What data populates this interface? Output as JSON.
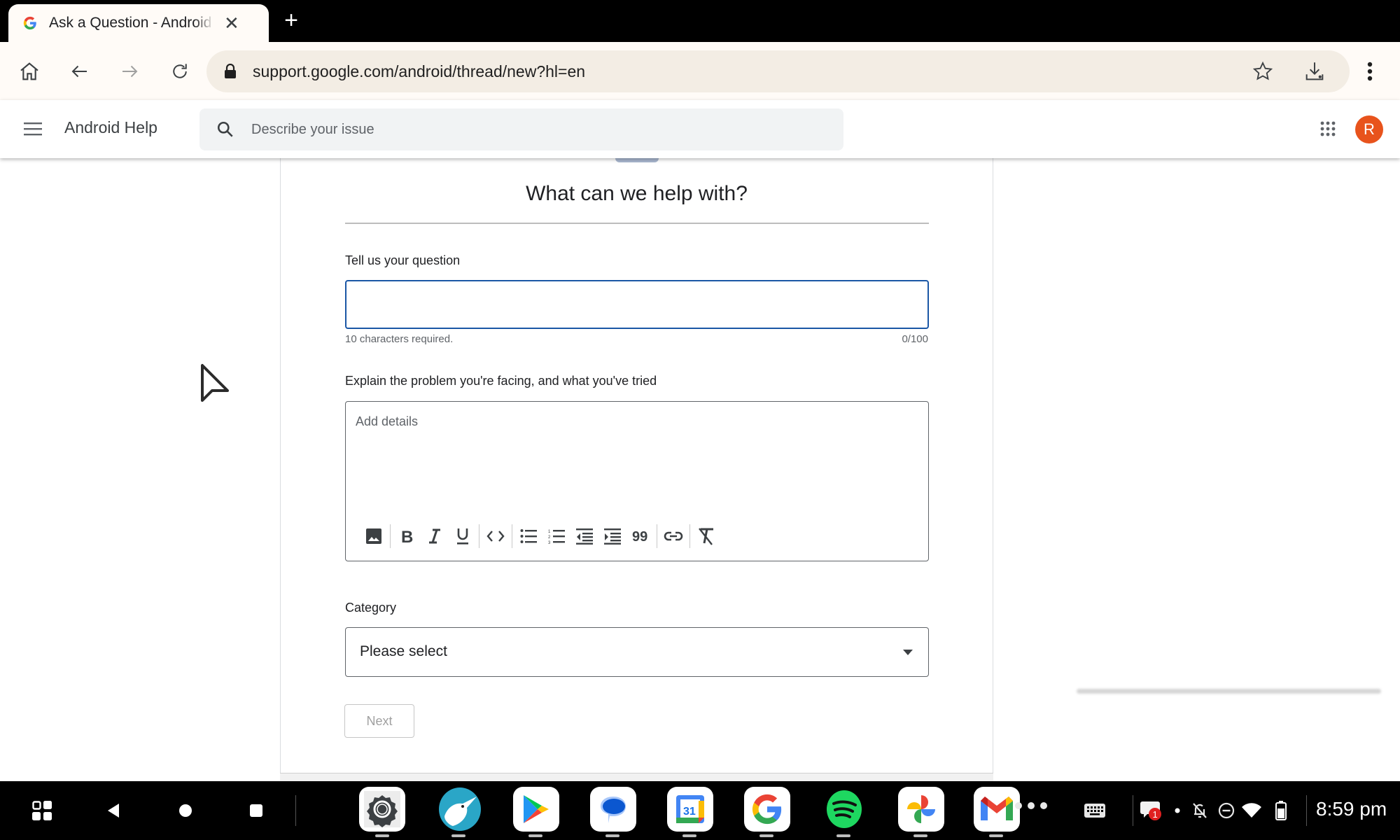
{
  "browser": {
    "tab": {
      "title": "Ask a Question - Android Community",
      "favicon": "google-g-icon",
      "close_icon": "close-icon"
    },
    "new_tab_icon": "plus-icon",
    "toolbar": {
      "home_icon": "home-icon",
      "back_icon": "arrow-left-icon",
      "forward_icon": "arrow-right-icon",
      "reload_icon": "reload-icon",
      "lock_icon": "lock-icon",
      "url": "support.google.com/android/thread/new?hl=en",
      "bookmark_icon": "star-icon",
      "download_icon": "download-icon",
      "menu_icon": "more-vert-icon"
    }
  },
  "app_header": {
    "menu_icon": "hamburger-icon",
    "title": "Android Help",
    "search_placeholder": "Describe your issue",
    "search_value": "",
    "apps_icon": "apps-grid-icon",
    "avatar_initial": "R",
    "avatar_color": "#e8531c"
  },
  "form": {
    "title": "What can we help with?",
    "question": {
      "label": "Tell us your question",
      "value": "",
      "helper": "10 characters required.",
      "counter": "0/100",
      "focus_color": "#1a56a5"
    },
    "details": {
      "label": "Explain the problem you're facing, and what you've tried",
      "placeholder": "Add details",
      "toolbar": [
        {
          "name": "insert-image",
          "icon": "image-icon"
        },
        {
          "name": "bold",
          "icon": "bold-icon",
          "glyph": "B"
        },
        {
          "name": "italic",
          "icon": "italic-icon",
          "glyph": "I"
        },
        {
          "name": "underline",
          "icon": "underline-icon",
          "glyph": "U"
        },
        {
          "name": "code",
          "icon": "code-icon",
          "glyph": "<>"
        },
        {
          "name": "bulleted-list",
          "icon": "bulleted-list-icon"
        },
        {
          "name": "numbered-list",
          "icon": "numbered-list-icon"
        },
        {
          "name": "outdent",
          "icon": "outdent-icon"
        },
        {
          "name": "indent",
          "icon": "indent-icon"
        },
        {
          "name": "quote",
          "icon": "quote-icon",
          "glyph": "99"
        },
        {
          "name": "link",
          "icon": "link-icon"
        },
        {
          "name": "clear-formatting",
          "icon": "clear-format-icon"
        }
      ]
    },
    "category": {
      "label": "Category",
      "selected": "Please select"
    },
    "next_button": "Next"
  },
  "taskbar": {
    "nav": [
      "app-drawer-icon",
      "back-triangle-icon",
      "home-circle-icon",
      "recents-square-icon"
    ],
    "apps": [
      {
        "name": "Settings",
        "icon": "settings-icon"
      },
      {
        "name": "Kiwi Browser",
        "icon": "kiwi-browser-icon"
      },
      {
        "name": "Play Store",
        "icon": "play-store-icon"
      },
      {
        "name": "Messages",
        "icon": "messages-icon"
      },
      {
        "name": "Calendar",
        "icon": "calendar-icon",
        "label": "31"
      },
      {
        "name": "Google",
        "icon": "google-icon"
      },
      {
        "name": "Spotify",
        "icon": "spotify-icon"
      },
      {
        "name": "Photos",
        "icon": "photos-icon"
      },
      {
        "name": "Gmail",
        "icon": "gmail-icon"
      }
    ],
    "overflow_icon": "more-horiz-icon",
    "keyboard_icon": "keyboard-icon",
    "notification_badge": "1",
    "status_icons": [
      "notification-icon",
      "dot-icon",
      "bell-off-icon",
      "do-not-disturb-icon",
      "wifi-icon",
      "battery-icon"
    ],
    "clock": "8:59 pm"
  }
}
